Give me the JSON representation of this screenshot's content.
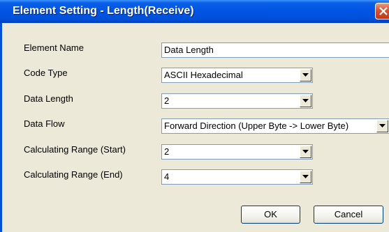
{
  "window": {
    "title": "Element Setting - Length(Receive)"
  },
  "fields": {
    "element_name": {
      "label": "Element Name",
      "value": "Data Length"
    },
    "code_type": {
      "label": "Code Type",
      "value": "ASCII Hexadecimal"
    },
    "data_length": {
      "label": "Data Length",
      "value": "2"
    },
    "data_flow": {
      "label": "Data Flow",
      "value": "Forward Direction (Upper Byte -> Lower Byte)"
    },
    "calc_start": {
      "label": "Calculating Range (Start)",
      "value": "2"
    },
    "calc_end": {
      "label": "Calculating Range (End)",
      "value": "4"
    }
  },
  "buttons": {
    "ok": "OK",
    "cancel": "Cancel"
  },
  "icons": {
    "close": "close-icon",
    "dropdown": "chevron-down-icon"
  },
  "colors": {
    "titlebar": "#0054E3",
    "dialog_bg": "#ECE9D8",
    "close": "#D45433"
  }
}
